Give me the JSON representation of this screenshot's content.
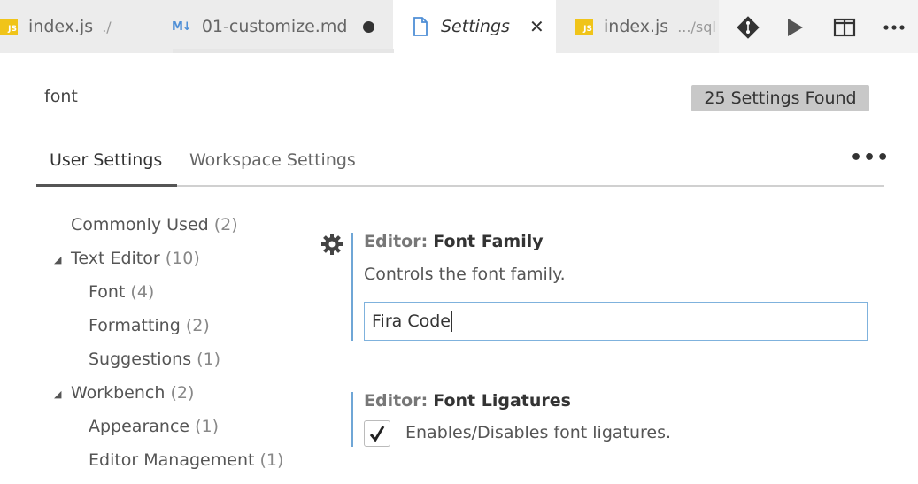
{
  "tabs": [
    {
      "label": "index.js",
      "description": "./",
      "icon": "js-file-icon"
    },
    {
      "label": "01-customize.md",
      "icon": "markdown-file-icon",
      "dirty": true
    },
    {
      "label": "Settings",
      "icon": "document-icon",
      "active": true
    },
    {
      "label": "index.js",
      "description": ".../sql",
      "icon": "js-file-icon"
    }
  ],
  "js_badge": "JS",
  "md_badge": "M↓",
  "actions": [
    "git-compare-icon",
    "run-icon",
    "split-editor-icon",
    "more-actions-icon"
  ],
  "search": {
    "value": "font",
    "results_badge": "25 Settings Found"
  },
  "settings_tabs": {
    "user": "User Settings",
    "workspace": "Workspace Settings",
    "more": "•••"
  },
  "toc": [
    {
      "label": "Commonly Used",
      "count": "(2)"
    },
    {
      "label": "Text Editor",
      "count": "(10)",
      "expanded": true
    },
    {
      "label": "Font",
      "count": "(4)"
    },
    {
      "label": "Formatting",
      "count": "(2)"
    },
    {
      "label": "Suggestions",
      "count": "(1)"
    },
    {
      "label": "Workbench",
      "count": "(2)",
      "expanded": true
    },
    {
      "label": "Appearance",
      "count": "(1)"
    },
    {
      "label": "Editor Management",
      "count": "(1)"
    }
  ],
  "settings": [
    {
      "category": "Editor:",
      "name": "Font Family",
      "description": "Controls the font family.",
      "value": "Fira Code"
    },
    {
      "category": "Editor:",
      "name": "Font Ligatures",
      "description": "Enables/Disables font ligatures.",
      "checked": true
    }
  ],
  "colors": {
    "accent": "#6fa6d6",
    "js_badge": "#f0c419",
    "markdown": "#4f8fd6"
  }
}
